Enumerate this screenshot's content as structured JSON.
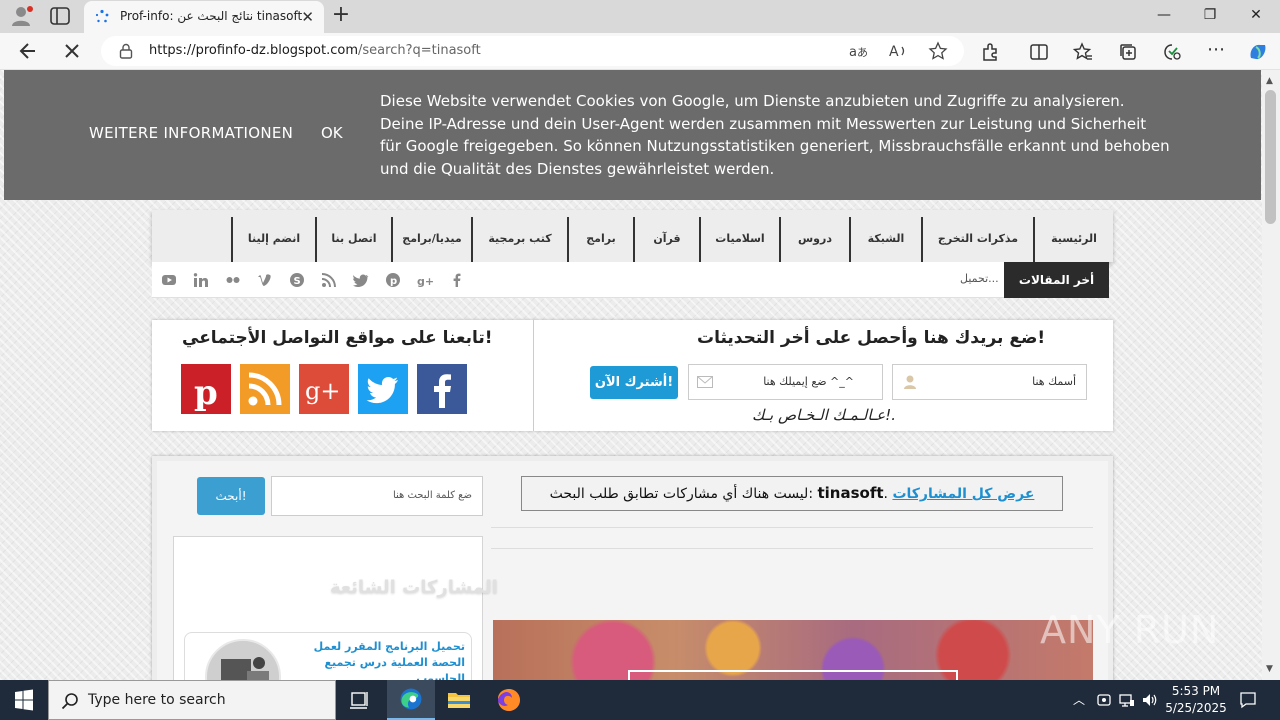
{
  "browser": {
    "tab_title": "Prof-info: نتائج البحث عن tinasoft",
    "tab_close": "✕",
    "new_tab": "+",
    "url_host": "https://profinfo-dz.blogspot.com",
    "url_path": "/search?q=tinasoft",
    "win_min": "—",
    "win_max": "❐",
    "win_close": "✕"
  },
  "cookie": {
    "more_label": "WEITERE INFORMATIONEN",
    "ok_label": "OK",
    "text": "Diese Website verwendet Cookies von Google, um Dienste anzubieten und Zugriffe zu analysieren. Deine IP-Adresse und dein User-Agent werden zusammen mit Messwerten zur Leistung und Sicherheit für Google freigegeben. So können Nutzungsstatistiken generiert, Missbrauchsfälle erkannt und behoben und die Qualität des Dienstes gewährleistet werden."
  },
  "nav": {
    "items": [
      "الرئيسية",
      "مذكرات التخرج",
      "الشبكة",
      "دروس",
      "اسلاميات",
      "قرآن",
      "برامج",
      "كتب برمجية",
      "ميديا/برامج",
      "اتصل بنا",
      "انضم إلينا"
    ]
  },
  "ticker": {
    "label": "أخر المقالات",
    "text": "تحميل..."
  },
  "subscribe": {
    "title": "ضع بريدك هنا وأحصل على أخر التحديثات!",
    "name_placeholder": "أسمك هنا",
    "email_placeholder": "ضع إيميلك هنا ^_^",
    "button": "أشترك الآن!",
    "tagline": "عـالـمـك الـخـاص بـك!."
  },
  "follow": {
    "title": "تابعنا على مواقع التواصل الأجتماعي!"
  },
  "search": {
    "button": "أبحث!",
    "placeholder": "ضع كلمة البحث هنا"
  },
  "results": {
    "message": "ليست هناك أي مشاركات تطابق طلب البحث:",
    "query": "tinasoft",
    "show_all": "عرض كل المشاركات"
  },
  "popular": {
    "title": "المشاركات الشائعة",
    "post_title": "تحميل البرنامج المقرر لعمل الحصة العملية درس تجميع الحاسوب"
  },
  "watermark": "ANY RUN",
  "taskbar": {
    "search_placeholder": "Type here to search",
    "time": "5:53 PM",
    "date": "5/25/2025"
  },
  "colors": {
    "cookie_bg": "#6b6b6b",
    "accent_blue": "#1e9bd7",
    "taskbar_bg": "#1f2b3a"
  }
}
